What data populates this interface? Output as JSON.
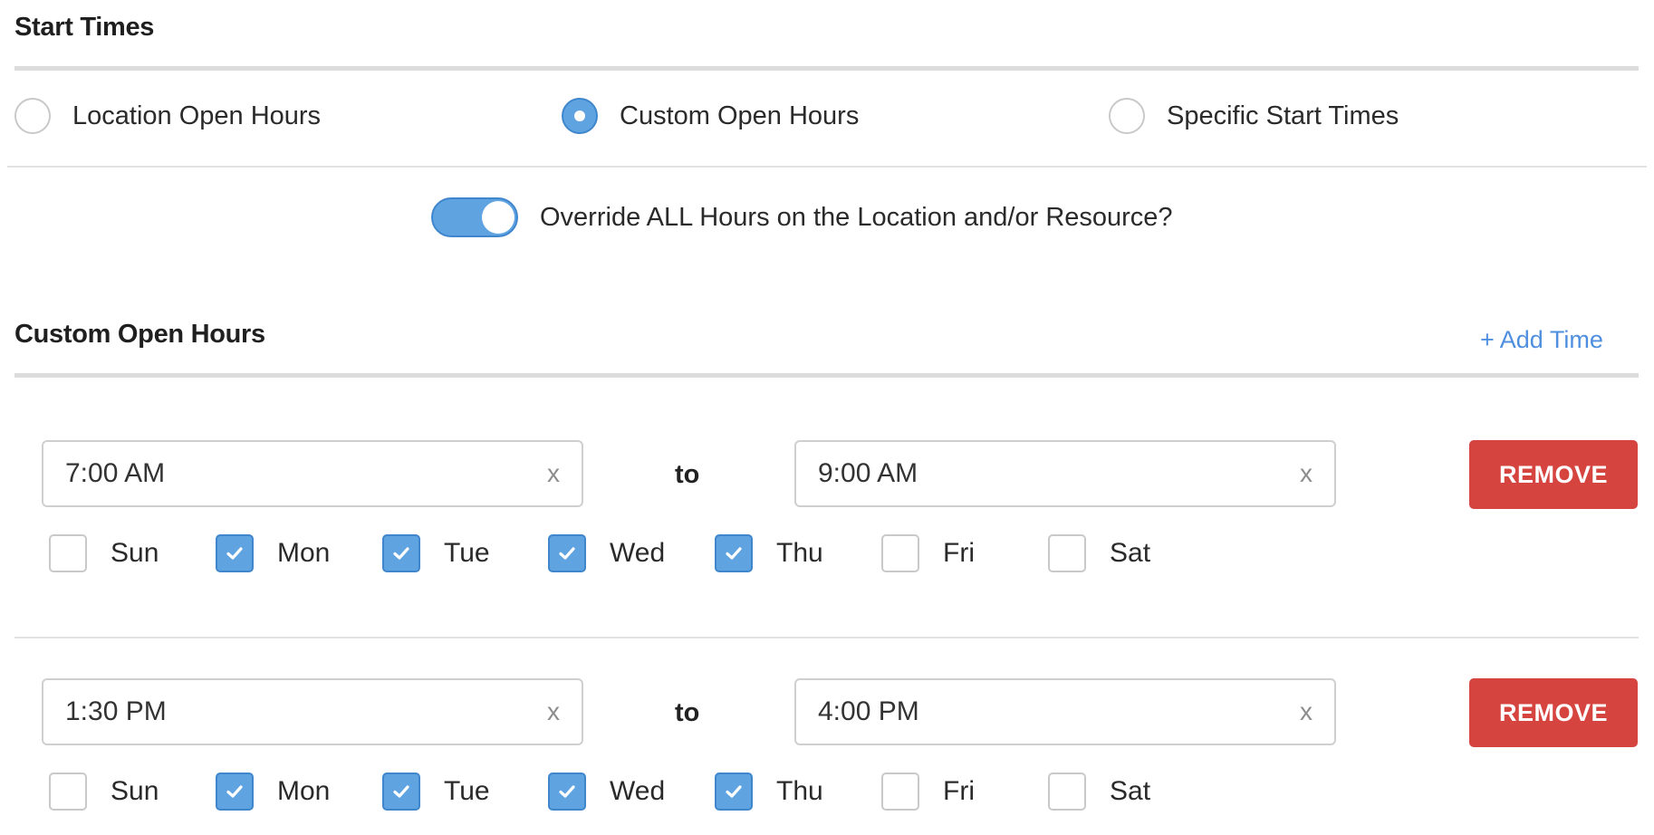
{
  "start_times": {
    "title": "Start Times",
    "options": [
      {
        "label": "Location Open Hours",
        "selected": false
      },
      {
        "label": "Custom Open Hours",
        "selected": true
      },
      {
        "label": "Specific Start Times",
        "selected": false
      }
    ]
  },
  "override": {
    "label": "Override ALL Hours on the Location and/or Resource?",
    "enabled": true
  },
  "custom_hours": {
    "title": "Custom Open Hours",
    "add_time_label": "+ Add Time",
    "to_label": "to",
    "clear_label": "x",
    "remove_label": "REMOVE",
    "rows": [
      {
        "start": "7:00 AM",
        "end": "9:00 AM",
        "days": [
          {
            "label": "Sun",
            "checked": false
          },
          {
            "label": "Mon",
            "checked": true
          },
          {
            "label": "Tue",
            "checked": true
          },
          {
            "label": "Wed",
            "checked": true
          },
          {
            "label": "Thu",
            "checked": true
          },
          {
            "label": "Fri",
            "checked": false
          },
          {
            "label": "Sat",
            "checked": false
          }
        ]
      },
      {
        "start": "1:30 PM",
        "end": "4:00 PM",
        "days": [
          {
            "label": "Sun",
            "checked": false
          },
          {
            "label": "Mon",
            "checked": true
          },
          {
            "label": "Tue",
            "checked": true
          },
          {
            "label": "Wed",
            "checked": true
          },
          {
            "label": "Thu",
            "checked": true
          },
          {
            "label": "Fri",
            "checked": false
          },
          {
            "label": "Sat",
            "checked": false
          }
        ]
      }
    ]
  },
  "colors": {
    "accent": "#5fa3e1",
    "link": "#4f8fdf",
    "danger": "#d5443f"
  }
}
